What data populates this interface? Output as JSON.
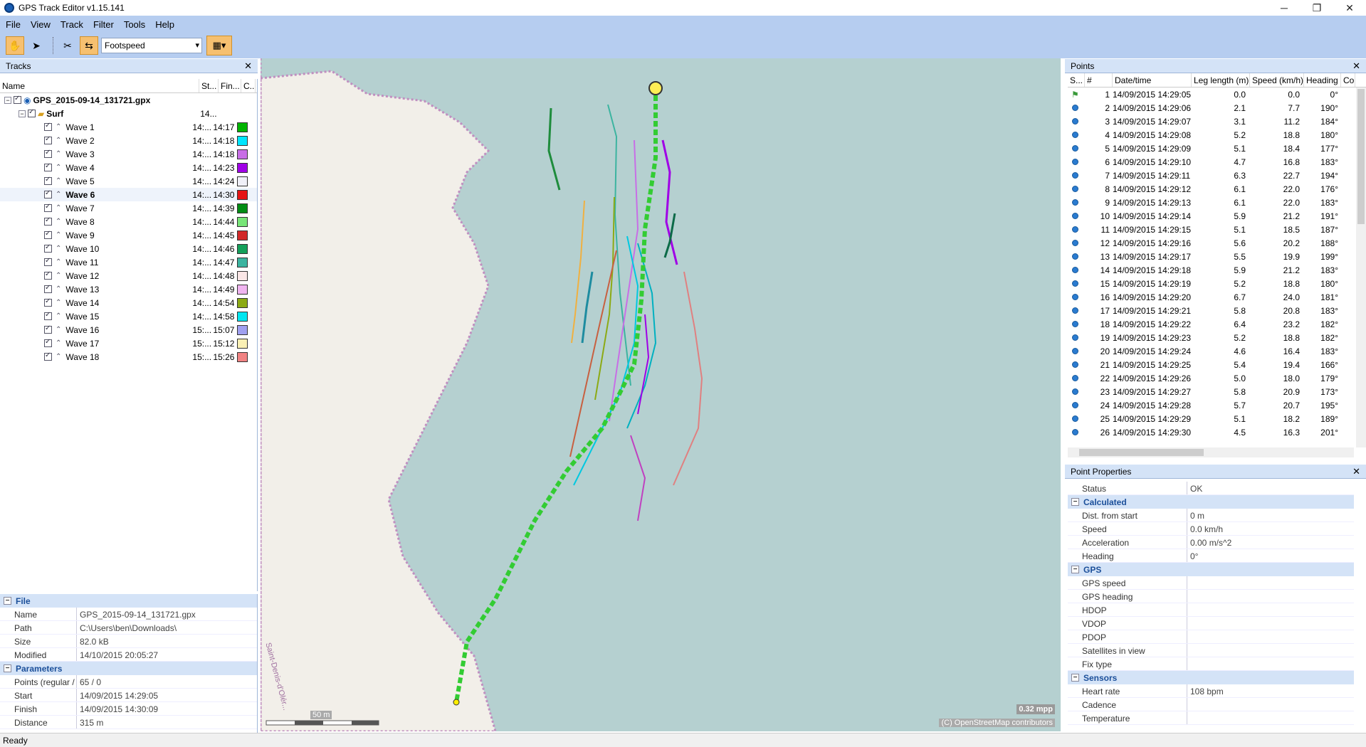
{
  "window": {
    "title": "GPS Track Editor v1.15.141"
  },
  "menu": [
    "File",
    "View",
    "Track",
    "Filter",
    "Tools",
    "Help"
  ],
  "toolbar": {
    "mode_select": "Footspeed"
  },
  "tracks_panel": {
    "title": "Tracks",
    "columns": [
      "Name",
      "St...",
      "Fin...",
      "C..."
    ],
    "file_name": "GPS_2015-09-14_131721.gpx",
    "group_name": "Surf",
    "group_start": "14...",
    "waves": [
      {
        "name": "Wave 1",
        "start": "14:...",
        "finish": "14:17",
        "color": "#00b400"
      },
      {
        "name": "Wave 2",
        "start": "14:...",
        "finish": "14:18",
        "color": "#00e6ff"
      },
      {
        "name": "Wave 3",
        "start": "14:...",
        "finish": "14:18",
        "color": "#c86ee6"
      },
      {
        "name": "Wave 4",
        "start": "14:...",
        "finish": "14:23",
        "color": "#a000e6"
      },
      {
        "name": "Wave 5",
        "start": "14:...",
        "finish": "14:24",
        "color": "#f0f0f8"
      },
      {
        "name": "Wave 6",
        "start": "14:...",
        "finish": "14:30",
        "color": "#e61414"
      },
      {
        "name": "Wave 7",
        "start": "14:...",
        "finish": "14:39",
        "color": "#008c14"
      },
      {
        "name": "Wave 8",
        "start": "14:...",
        "finish": "14:44",
        "color": "#78e678"
      },
      {
        "name": "Wave 9",
        "start": "14:...",
        "finish": "14:45",
        "color": "#d22828"
      },
      {
        "name": "Wave 10",
        "start": "14:...",
        "finish": "14:46",
        "color": "#14a05a"
      },
      {
        "name": "Wave 11",
        "start": "14:...",
        "finish": "14:47",
        "color": "#3cb4a0"
      },
      {
        "name": "Wave 12",
        "start": "14:...",
        "finish": "14:48",
        "color": "#fae6e6"
      },
      {
        "name": "Wave 13",
        "start": "14:...",
        "finish": "14:49",
        "color": "#f0b4f0"
      },
      {
        "name": "Wave 14",
        "start": "14:...",
        "finish": "14:54",
        "color": "#8caa14"
      },
      {
        "name": "Wave 15",
        "start": "14:...",
        "finish": "14:58",
        "color": "#00e6f0"
      },
      {
        "name": "Wave 16",
        "start": "15:...",
        "finish": "15:07",
        "color": "#a0a0f0"
      },
      {
        "name": "Wave 17",
        "start": "15:...",
        "finish": "15:12",
        "color": "#faf0b4"
      },
      {
        "name": "Wave 18",
        "start": "15:...",
        "finish": "15:26",
        "color": "#f08282"
      }
    ],
    "selected_index": 5
  },
  "file_props": {
    "section_file": "File",
    "file": [
      {
        "k": "Name",
        "v": "GPS_2015-09-14_131721.gpx"
      },
      {
        "k": "Path",
        "v": "C:\\Users\\ben\\Downloads\\"
      },
      {
        "k": "Size",
        "v": "82.0 kB"
      },
      {
        "k": "Modified",
        "v": "14/10/2015 20:05:27"
      }
    ],
    "section_params": "Parameters",
    "params": [
      {
        "k": "Points (regular / filt",
        "v": "65 / 0"
      },
      {
        "k": "Start",
        "v": "14/09/2015 14:29:05"
      },
      {
        "k": "Finish",
        "v": "14/09/2015 14:30:09"
      },
      {
        "k": "Distance",
        "v": "315 m"
      }
    ]
  },
  "map": {
    "scale_label": "50 m",
    "mpp": "0.32 mpp",
    "attribution": "(C) OpenStreetMap contributors",
    "place_label": "Saint-Denis-d'Olér..."
  },
  "points_panel": {
    "title": "Points",
    "columns": [
      "S...",
      "#",
      "Date/time",
      "Leg length (m)",
      "Speed (km/h)",
      "Heading",
      "Co"
    ],
    "rows": [
      {
        "n": "1",
        "t": "14/09/2015  14:29:05",
        "leg": "0.0",
        "spd": "0.0",
        "hd": "0°"
      },
      {
        "n": "2",
        "t": "14/09/2015  14:29:06",
        "leg": "2.1",
        "spd": "7.7",
        "hd": "190°"
      },
      {
        "n": "3",
        "t": "14/09/2015  14:29:07",
        "leg": "3.1",
        "spd": "11.2",
        "hd": "184°"
      },
      {
        "n": "4",
        "t": "14/09/2015  14:29:08",
        "leg": "5.2",
        "spd": "18.8",
        "hd": "180°"
      },
      {
        "n": "5",
        "t": "14/09/2015  14:29:09",
        "leg": "5.1",
        "spd": "18.4",
        "hd": "177°"
      },
      {
        "n": "6",
        "t": "14/09/2015  14:29:10",
        "leg": "4.7",
        "spd": "16.8",
        "hd": "183°"
      },
      {
        "n": "7",
        "t": "14/09/2015  14:29:11",
        "leg": "6.3",
        "spd": "22.7",
        "hd": "194°"
      },
      {
        "n": "8",
        "t": "14/09/2015  14:29:12",
        "leg": "6.1",
        "spd": "22.0",
        "hd": "176°"
      },
      {
        "n": "9",
        "t": "14/09/2015  14:29:13",
        "leg": "6.1",
        "spd": "22.0",
        "hd": "183°"
      },
      {
        "n": "10",
        "t": "14/09/2015  14:29:14",
        "leg": "5.9",
        "spd": "21.2",
        "hd": "191°"
      },
      {
        "n": "11",
        "t": "14/09/2015  14:29:15",
        "leg": "5.1",
        "spd": "18.5",
        "hd": "187°"
      },
      {
        "n": "12",
        "t": "14/09/2015  14:29:16",
        "leg": "5.6",
        "spd": "20.2",
        "hd": "188°"
      },
      {
        "n": "13",
        "t": "14/09/2015  14:29:17",
        "leg": "5.5",
        "spd": "19.9",
        "hd": "199°"
      },
      {
        "n": "14",
        "t": "14/09/2015  14:29:18",
        "leg": "5.9",
        "spd": "21.2",
        "hd": "183°"
      },
      {
        "n": "15",
        "t": "14/09/2015  14:29:19",
        "leg": "5.2",
        "spd": "18.8",
        "hd": "180°"
      },
      {
        "n": "16",
        "t": "14/09/2015  14:29:20",
        "leg": "6.7",
        "spd": "24.0",
        "hd": "181°"
      },
      {
        "n": "17",
        "t": "14/09/2015  14:29:21",
        "leg": "5.8",
        "spd": "20.8",
        "hd": "183°"
      },
      {
        "n": "18",
        "t": "14/09/2015  14:29:22",
        "leg": "6.4",
        "spd": "23.2",
        "hd": "182°"
      },
      {
        "n": "19",
        "t": "14/09/2015  14:29:23",
        "leg": "5.2",
        "spd": "18.8",
        "hd": "182°"
      },
      {
        "n": "20",
        "t": "14/09/2015  14:29:24",
        "leg": "4.6",
        "spd": "16.4",
        "hd": "183°"
      },
      {
        "n": "21",
        "t": "14/09/2015  14:29:25",
        "leg": "5.4",
        "spd": "19.4",
        "hd": "166°"
      },
      {
        "n": "22",
        "t": "14/09/2015  14:29:26",
        "leg": "5.0",
        "spd": "18.0",
        "hd": "179°"
      },
      {
        "n": "23",
        "t": "14/09/2015  14:29:27",
        "leg": "5.8",
        "spd": "20.9",
        "hd": "173°"
      },
      {
        "n": "24",
        "t": "14/09/2015  14:29:28",
        "leg": "5.7",
        "spd": "20.7",
        "hd": "195°"
      },
      {
        "n": "25",
        "t": "14/09/2015  14:29:29",
        "leg": "5.1",
        "spd": "18.2",
        "hd": "189°"
      },
      {
        "n": "26",
        "t": "14/09/2015  14:29:30",
        "leg": "4.5",
        "spd": "16.3",
        "hd": "201°"
      }
    ]
  },
  "point_props": {
    "title": "Point Properties",
    "status_row": {
      "k": "Status",
      "v": "OK"
    },
    "section_calc": "Calculated",
    "calculated": [
      {
        "k": "Dist. from start",
        "v": "0 m"
      },
      {
        "k": "Speed",
        "v": "0.0 km/h"
      },
      {
        "k": "Acceleration",
        "v": "0.00 m/s^2"
      },
      {
        "k": "Heading",
        "v": "0°"
      }
    ],
    "section_gps": "GPS",
    "gps": [
      {
        "k": "GPS speed",
        "v": ""
      },
      {
        "k": "GPS heading",
        "v": ""
      },
      {
        "k": "HDOP",
        "v": ""
      },
      {
        "k": "VDOP",
        "v": ""
      },
      {
        "k": "PDOP",
        "v": ""
      },
      {
        "k": "Satellites in view",
        "v": ""
      },
      {
        "k": "Fix type",
        "v": ""
      }
    ],
    "section_sensors": "Sensors",
    "sensors": [
      {
        "k": "Heart rate",
        "v": "108 bpm"
      },
      {
        "k": "Cadence",
        "v": ""
      },
      {
        "k": "Temperature",
        "v": ""
      }
    ]
  },
  "status": {
    "text": "Ready"
  }
}
